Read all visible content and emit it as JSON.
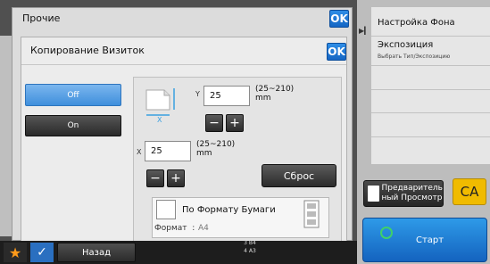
{
  "outer": {
    "title": "Прочие",
    "ok": "OK"
  },
  "dialog": {
    "title": "Копирование Визиток",
    "ok": "OK"
  },
  "mode": {
    "off": "Off",
    "on": "On"
  },
  "size": {
    "y_axis": "Y",
    "x_axis": "X",
    "y_value": "25",
    "x_value": "25",
    "range_line1": "(25~210)",
    "range_line2": "mm",
    "minus": "−",
    "plus": "+"
  },
  "reset": "Сброс",
  "paper": {
    "checkbox_label": "По Формату Бумаги",
    "format_label": "Формат",
    "format_sep": ":",
    "format_value": "A4"
  },
  "right_menu": {
    "item1": "Настройка Фона",
    "item2": "Экспозиция",
    "item2_sub": "Выбрать Тип/Экспозицию"
  },
  "preview": {
    "line1": "Предваритель",
    "line2": "ный Просмотр"
  },
  "ca": "CA",
  "start": "Старт",
  "bottom": {
    "back": "Назад"
  },
  "tray": {
    "t1": "3",
    "b4": "B4",
    "t2": "4",
    "a3": "A3"
  },
  "colors": {
    "accent": "#1f77d4",
    "ca": "#f0bb00",
    "start_icon": "#3fd06a",
    "star": "#ff9a1a"
  }
}
